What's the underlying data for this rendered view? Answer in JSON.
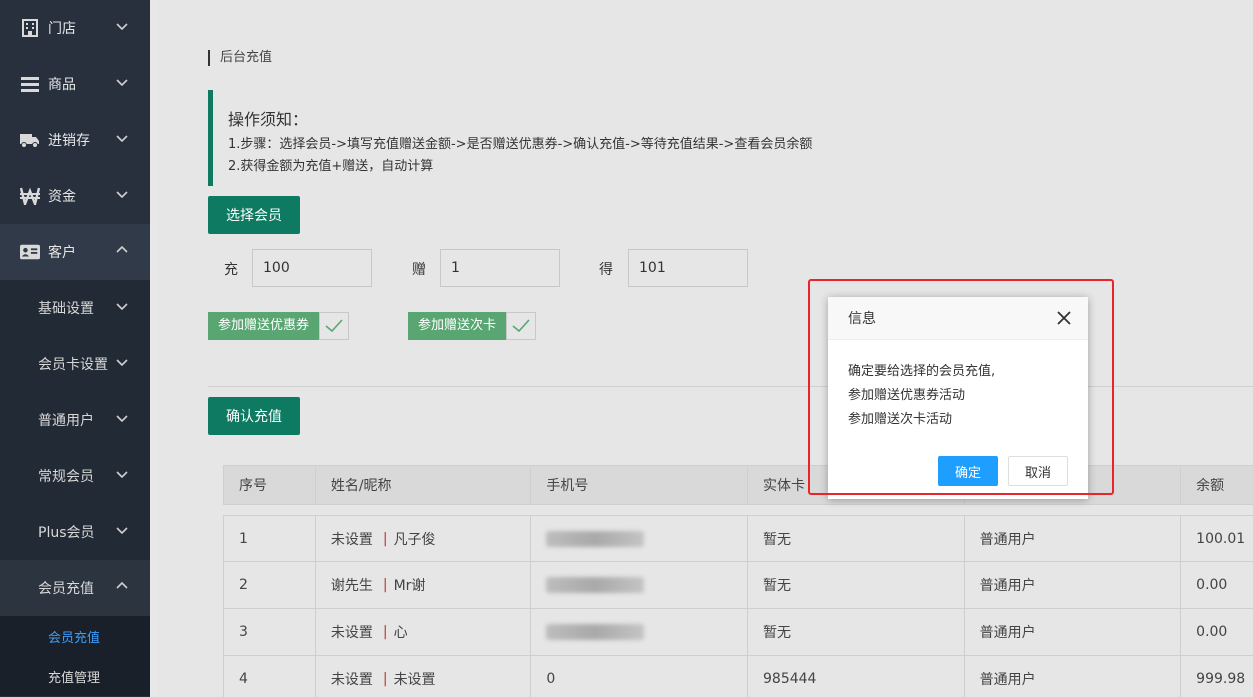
{
  "sidebar": {
    "items": [
      {
        "label": "门店",
        "icon": "building-icon"
      },
      {
        "label": "商品",
        "icon": "list-icon"
      },
      {
        "label": "进销存",
        "icon": "truck-icon"
      },
      {
        "label": "资金",
        "icon": "won-icon"
      },
      {
        "label": "客户",
        "icon": "id-card-icon"
      }
    ],
    "sub_items": [
      {
        "label": "基础设置"
      },
      {
        "label": "会员卡设置"
      },
      {
        "label": "普通用户"
      },
      {
        "label": "常规会员"
      },
      {
        "label": "Plus会员"
      },
      {
        "label": "会员充值"
      }
    ],
    "sub_sub_items": [
      {
        "label": "会员充值"
      },
      {
        "label": "充值管理"
      }
    ]
  },
  "breadcrumb": "后台充值",
  "notice": {
    "title": "操作须知：",
    "line1": "1.步骤：选择会员->填写充值赠送金额->是否赠送优惠券->确认充值->等待充值结果->查看会员余额",
    "line2": "2.获得金额为充值+赠送，自动计算"
  },
  "select_member_label": "选择会员",
  "fields": {
    "recharge_label": "充",
    "recharge_value": "100",
    "gift_label": "赠",
    "gift_value": "1",
    "get_label": "得",
    "get_value": "101"
  },
  "checks": {
    "coupon_label": "参加赠送优惠券",
    "card_label": "参加赠送次卡"
  },
  "confirm_label": "确认充值",
  "table": {
    "headers": [
      "序号",
      "姓名/昵称",
      "手机号",
      "实体卡",
      "",
      "余额"
    ],
    "rows": [
      {
        "no": "1",
        "name": "未设置",
        "nick": "凡子俊",
        "phone": "13800000000",
        "card": "暂无",
        "type": "普通用户",
        "balance": "100.01"
      },
      {
        "no": "2",
        "name": "谢先生",
        "nick": "Mr谢",
        "phone": "13800000007",
        "card": "暂无",
        "type": "普通用户",
        "balance": "0.00"
      },
      {
        "no": "3",
        "name": "未设置",
        "nick": "心",
        "phone": "13800000003",
        "card": "暂无",
        "type": "普通用户",
        "balance": "0.00"
      },
      {
        "no": "4",
        "name": "未设置",
        "nick": "未设置",
        "phone": "0",
        "card": "985444",
        "type": "普通用户",
        "balance": "999.98"
      }
    ]
  },
  "dialog": {
    "title": "信息",
    "line1": "确定要给选择的会员充值,",
    "line2": "参加赠送优惠券活动",
    "line3": "参加赠送次卡活动",
    "ok_label": "确定",
    "cancel_label": "取消"
  },
  "colors": {
    "sidebar_bg": "#28303d",
    "primary_green": "#0e7a62",
    "check_green": "#5aa673",
    "ok_blue": "#1e9fff",
    "highlight_red": "#e8262a",
    "active_link": "#3a9fff"
  }
}
